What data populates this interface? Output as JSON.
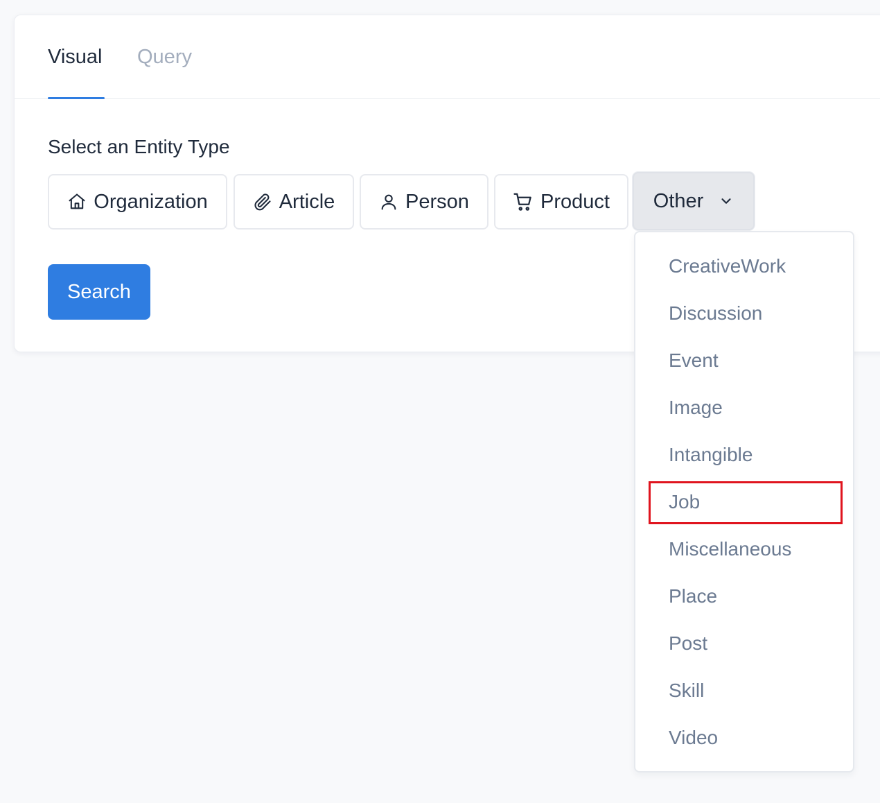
{
  "tabs": {
    "visual": "Visual",
    "query": "Query"
  },
  "section_label": "Select an Entity Type",
  "entity_buttons": {
    "organization": "Organization",
    "article": "Article",
    "person": "Person",
    "product": "Product",
    "other": "Other"
  },
  "icons": {
    "organization": "home-icon",
    "article": "paperclip-icon",
    "person": "user-icon",
    "product": "shopping-cart-icon",
    "other": "chevron-down-icon"
  },
  "search_label": "Search",
  "other_menu": {
    "items": [
      "CreativeWork",
      "Discussion",
      "Event",
      "Image",
      "Intangible",
      "Job",
      "Miscellaneous",
      "Place",
      "Post",
      "Skill",
      "Video"
    ],
    "highlighted": "Job"
  },
  "colors": {
    "primary": "#2f7de1",
    "text": "#1f2a3b",
    "muted": "#a3adbd",
    "menu_text": "#6b7a91",
    "highlight": "#e0141e"
  }
}
